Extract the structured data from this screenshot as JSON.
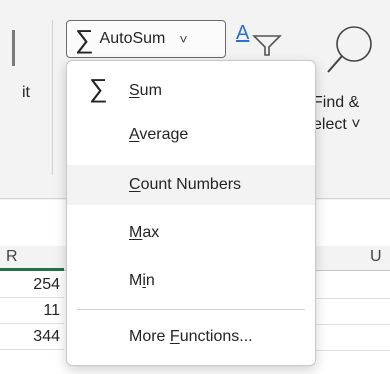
{
  "ribbon": {
    "left_fragment_label": "it",
    "autosum_button": {
      "icon": "sigma-icon",
      "label": "AutoSum"
    },
    "find_select": {
      "line1": "Find &",
      "line2": "elect",
      "chevron": "˅"
    }
  },
  "menu": {
    "items": [
      {
        "id": "sum",
        "pre": "",
        "ul": "S",
        "post": "um",
        "icon": "sigma-icon"
      },
      {
        "id": "average",
        "pre": "",
        "ul": "A",
        "post": "verage"
      },
      {
        "id": "count-numbers",
        "pre": "",
        "ul": "C",
        "post": "ount Numbers"
      },
      {
        "id": "max",
        "pre": "",
        "ul": "M",
        "post": "ax"
      },
      {
        "id": "min",
        "pre": "M",
        "ul": "i",
        "post": "n"
      },
      {
        "id": "more-functions",
        "pre": "More ",
        "ul": "F",
        "post": "unctions..."
      }
    ],
    "highlighted": "count-numbers"
  },
  "sheet": {
    "columns": [
      "R",
      "U"
    ],
    "cells": [
      "254",
      "11",
      "344"
    ]
  }
}
